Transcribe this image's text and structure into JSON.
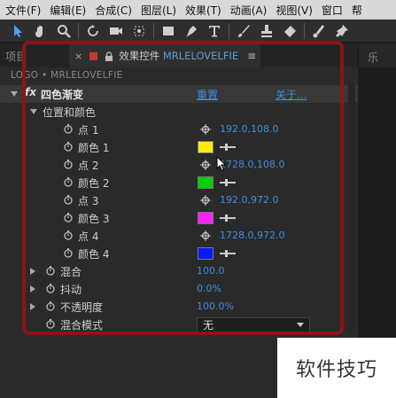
{
  "menubar": {
    "items": [
      "文件(F)",
      "编辑(E)",
      "合成(C)",
      "图层(L)",
      "效果(T)",
      "动画(A)",
      "视图(V)",
      "窗口",
      "帮"
    ]
  },
  "toolbar": {
    "tools": [
      "selection-tool-icon",
      "hand-tool-icon",
      "zoom-tool-icon",
      "rotate-tool-icon",
      "camera-tool-icon",
      "pan-behind-tool-icon",
      "rectangle-tool-icon",
      "pen-tool-icon",
      "text-tool-icon",
      "brush-tool-icon",
      "clone-stamp-tool-icon",
      "eraser-tool-icon",
      "roto-brush-tool-icon",
      "puppet-tool-icon"
    ]
  },
  "tabs": {
    "project": "项目",
    "effects_close": "×",
    "effects_title_prefix": "效果控件",
    "effects_title_layer": "MRLELOVELFIE",
    "effects_menu": "≡",
    "right_pane": "乐"
  },
  "panel": {
    "header": "LOGO • MRLELOVELFIE",
    "effect": {
      "fx": "fx",
      "name": "四色渐变",
      "reset": "重置",
      "about": "关于..."
    },
    "group": "位置和颜色",
    "params": [
      {
        "label": "点 1",
        "value": "192.0,108.0"
      },
      {
        "label": "颜色 1",
        "color": "#ffee00"
      },
      {
        "label": "点 2",
        "value": "1728.0,108.0"
      },
      {
        "label": "颜色 2",
        "color": "#00d000"
      },
      {
        "label": "点 3",
        "value": "192.0,972.0"
      },
      {
        "label": "颜色 3",
        "color": "#ff22ff"
      },
      {
        "label": "点 4",
        "value": "1728.0,972.0"
      },
      {
        "label": "颜色 4",
        "color": "#0a18ff"
      }
    ],
    "extras": [
      {
        "label": "混合",
        "value": "100.0"
      },
      {
        "label": "抖动",
        "value": "0.0%"
      },
      {
        "label": "不透明度",
        "value": "100.0%"
      }
    ],
    "blend_mode": {
      "label": "混合模式",
      "value": "无"
    }
  },
  "watermark": "软件技巧"
}
